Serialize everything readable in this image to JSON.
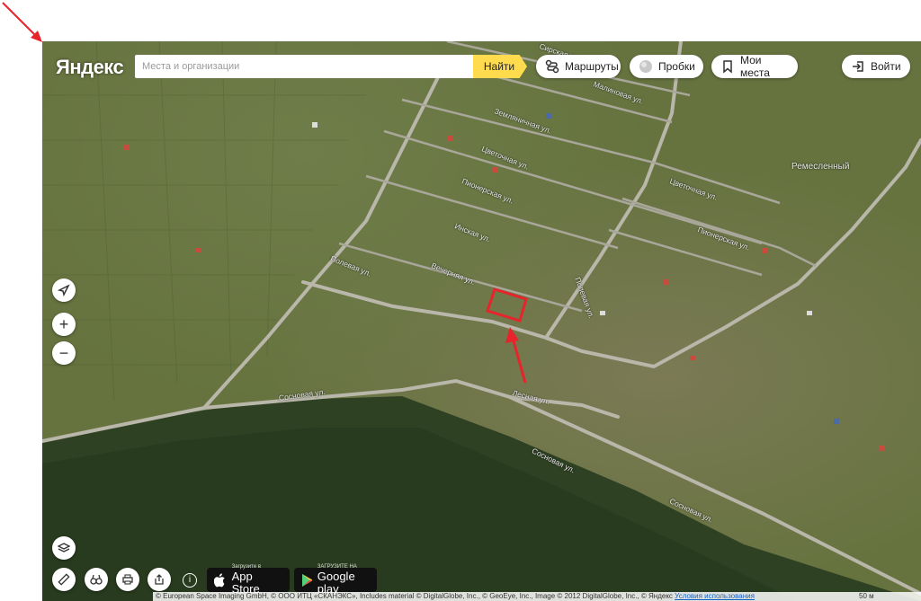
{
  "header": {
    "logo": "Яндекс",
    "search_placeholder": "Места и организации",
    "find_label": "Найти",
    "routes_label": "Маршруты",
    "traffic_label": "Пробки",
    "my_places_label": "Мои места",
    "login_label": "Войти"
  },
  "streets": {
    "s1": "Сосновая ул.",
    "s2": "Сосновая ул.",
    "s3": "Сосновая ул.",
    "lesnaya": "Лесная ул.",
    "vechernyaya": "Вечерняя ул.",
    "polevaya1": "Полевая ул.",
    "polevaya2": "Полевая ул.",
    "inskaya": "Инская ул.",
    "pionerskaya1": "Пионерская ул.",
    "pionerskaya2": "Пионерская ул.",
    "tsvetochnaya1": "Цветочная ул.",
    "tsvetochnaya2": "Цветочная ул.",
    "zemlyanichnaya": "Земляничная ул.",
    "malinovaya": "Малиновая ул.",
    "sirskaya": "Сирская ул.",
    "remeslenny": "Ремесленный"
  },
  "store": {
    "appstore_small": "Загрузите в",
    "appstore_big": "App Store",
    "gplay_small": "ЗАГРУЗИТЕ НА",
    "gplay_big": "Google play"
  },
  "footer": {
    "copyright": "© European Space Imaging GmbH, © ООО ИТЦ «СКАНЭКС», Includes material © DigitalGlobe, Inc., © GeoEye, Inc., Image © 2012 DigitalGlobe, Inc., © Яндекс",
    "terms": "Условия использования",
    "scale": "50 м"
  },
  "colors": {
    "accent": "#ffdb4d",
    "marker": "#e8232b"
  },
  "icons": [
    "routes-icon",
    "traffic-icon",
    "bookmark-icon",
    "login-icon",
    "locate-icon",
    "zoom-in-icon",
    "zoom-out-icon",
    "layers-icon",
    "ruler-icon",
    "panorama-icon",
    "print-icon",
    "share-icon",
    "info-icon",
    "apple-icon",
    "play-icon"
  ]
}
